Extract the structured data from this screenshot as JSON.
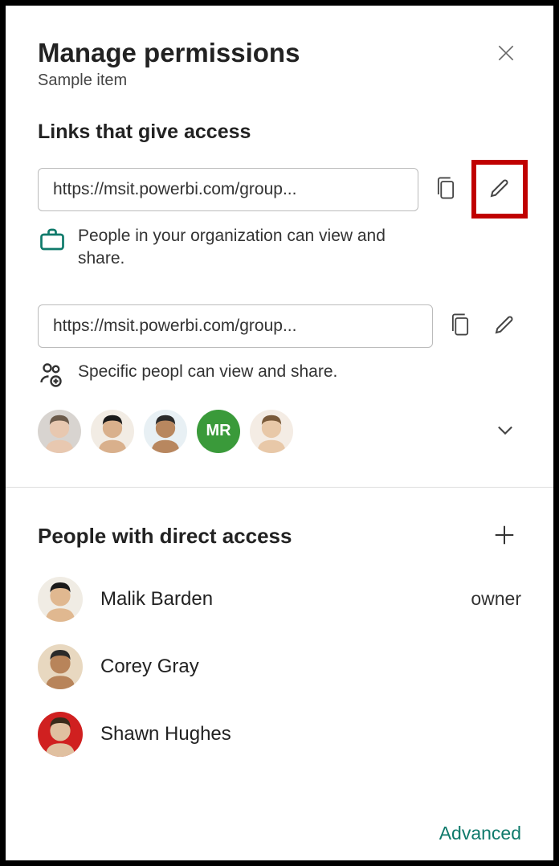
{
  "header": {
    "title": "Manage permissions",
    "subtitle": "Sample item"
  },
  "links_section": {
    "heading": "Links that give access",
    "items": [
      {
        "url": "https://msit.powerbi.com/group...",
        "description": "People in your organization can view and share.",
        "icon": "briefcase"
      },
      {
        "url": "https://msit.powerbi.com/group...",
        "description": "Specific peopl can view and share.",
        "icon": "people-add"
      }
    ],
    "avatars": [
      {
        "type": "photo",
        "bg": "#d8d4d0",
        "hair": "#6b5a4a",
        "skin": "#e8c8b0"
      },
      {
        "type": "photo",
        "bg": "#f2ece4",
        "hair": "#1a1a1a",
        "skin": "#d9b08c"
      },
      {
        "type": "photo",
        "bg": "#e8f0f4",
        "hair": "#2a2a2a",
        "skin": "#b8875f"
      },
      {
        "type": "initials",
        "text": "MR",
        "bg": "#3a9a3a"
      },
      {
        "type": "photo",
        "bg": "#f4ece4",
        "hair": "#7a5a3a",
        "skin": "#e8c8a8"
      }
    ]
  },
  "direct_section": {
    "heading": "People with direct access",
    "people": [
      {
        "name": "Malik Barden",
        "role": "owner",
        "hair": "#1a1a1a",
        "skin": "#e0b890",
        "bg": "#f0ece4"
      },
      {
        "name": "Corey Gray",
        "role": "",
        "hair": "#2a2a2a",
        "skin": "#b8845a",
        "bg": "#e8d8c0"
      },
      {
        "name": "Shawn Hughes",
        "role": "",
        "hair": "#3a2a1a",
        "skin": "#e0c0a0",
        "bg": "#d02020"
      }
    ]
  },
  "footer": {
    "advanced": "Advanced"
  }
}
